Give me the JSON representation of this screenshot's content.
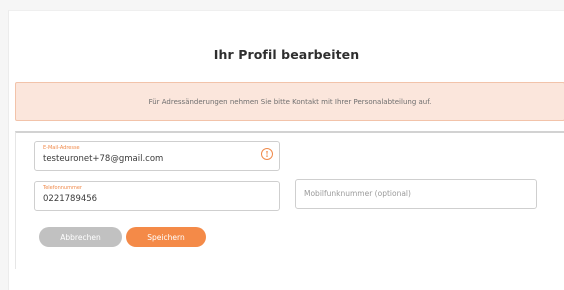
{
  "page": {
    "title": "Ihr Profil bearbeiten",
    "notice": "Für Adressänderungen nehmen Sie bitte Kontakt mit Ihrer Personalabteilung auf."
  },
  "form": {
    "email": {
      "label": "E-Mail-Adresse",
      "value": "testeuronet+78@gmail.com"
    },
    "phone": {
      "label": "Telefonnummer",
      "value": "0221789456"
    },
    "mobile": {
      "placeholder": "Mobilfunknummer (optional)"
    },
    "cancel_label": "Abbrechen",
    "save_label": "Speichern"
  },
  "colors": {
    "accent": "#f48a48",
    "notice_bg": "#fbe6dc",
    "notice_border": "#f2c3aa",
    "cancel_bg": "#c1c1c1"
  },
  "icons": {
    "email_field_icon": "info-icon"
  }
}
